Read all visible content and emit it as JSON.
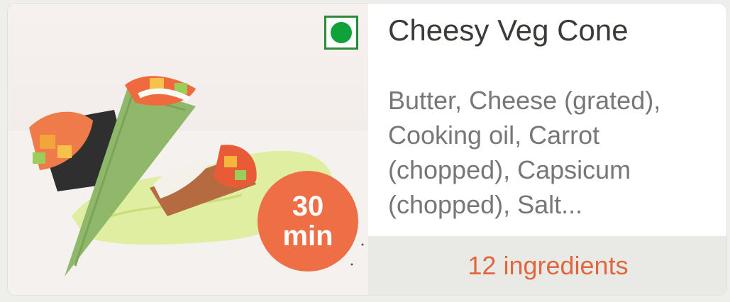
{
  "recipe": {
    "title": "Cheesy Veg Cone",
    "ingredients": "Butter, Cheese (grated), Cooking oil, Carrot (chopped), Capsicum (chopped), Salt...",
    "ingredient_count": "12 ingredients",
    "time_value": "30",
    "time_unit": "min",
    "diet": "veg"
  },
  "icons": {
    "veg_mark": "veg-indicator-icon"
  },
  "colors": {
    "badge": "#ee6e45",
    "veg_green": "#0fa13a",
    "count_text": "#e0673f",
    "footer_bg": "#e9e9e5"
  }
}
